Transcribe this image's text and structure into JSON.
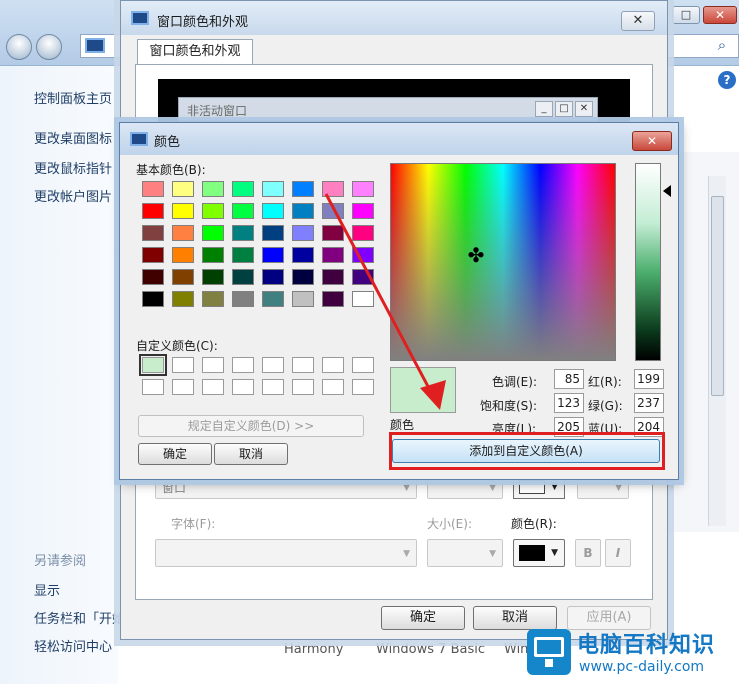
{
  "control_panel": {
    "sidebar_links": [
      "控制面板主页",
      "更改桌面图标",
      "更改鼠标指针",
      "更改帐户图片"
    ],
    "see_also_title": "另请参阅",
    "see_also_links": [
      "显示",
      "任务栏和「开始」菜单",
      "轻松访问中心"
    ],
    "bottom_themes": [
      "Harmony",
      "Windows 7 Basic",
      "Windows"
    ]
  },
  "window_color_dialog": {
    "title": "窗口颜色和外观",
    "tab": "窗口颜色和外观",
    "inactive_window_label": "非活动窗口",
    "item_value": "窗口",
    "font_label": "字体(F):",
    "size_label": "大小(E):",
    "color_label": "颜色(R):",
    "bold_label": "B",
    "italic_label": "I",
    "ok": "确定",
    "cancel": "取消",
    "apply": "应用(A)"
  },
  "color_dialog": {
    "title": "颜色",
    "basic_colors_label": "基本颜色(B):",
    "custom_colors_label": "自定义颜色(C):",
    "define_custom_button": "规定自定义颜色(D) >>",
    "ok": "确定",
    "cancel": "取消",
    "color_solid_label": "颜色",
    "hue_label": "色调(E):",
    "saturation_label": "饱和度(S):",
    "luminance_label": "亮度(L):",
    "red_label": "红(R):",
    "green_label": "绿(G):",
    "blue_label": "蓝(U):",
    "hue": "85",
    "saturation": "123",
    "luminance": "205",
    "red": "199",
    "green": "237",
    "blue": "204",
    "add_to_custom_button": "添加到自定义颜色(A)",
    "basic_colors": [
      "#ff8080",
      "#ffff80",
      "#80ff80",
      "#00ff80",
      "#80ffff",
      "#0080ff",
      "#ff80c0",
      "#ff80ff",
      "#ff0000",
      "#ffff00",
      "#80ff00",
      "#00ff40",
      "#00ffff",
      "#0080c0",
      "#8080c0",
      "#ff00ff",
      "#804040",
      "#ff8040",
      "#00ff00",
      "#008080",
      "#004080",
      "#8080ff",
      "#800040",
      "#ff0080",
      "#800000",
      "#ff8000",
      "#008000",
      "#008040",
      "#0000ff",
      "#0000a0",
      "#800080",
      "#8000ff",
      "#400000",
      "#804000",
      "#004000",
      "#004040",
      "#000080",
      "#000040",
      "#400040",
      "#400080",
      "#000000",
      "#808000",
      "#808040",
      "#808080",
      "#408080",
      "#c0c0c0",
      "#400040",
      "#ffffff"
    ],
    "custom_colors": [
      "#c7edcc",
      "#ffffff",
      "#ffffff",
      "#ffffff",
      "#ffffff",
      "#ffffff",
      "#ffffff",
      "#ffffff",
      "#ffffff",
      "#ffffff",
      "#ffffff",
      "#ffffff",
      "#ffffff",
      "#ffffff",
      "#ffffff",
      "#ffffff"
    ],
    "selected_color": "#c7edcc"
  },
  "watermark": {
    "name": "电脑百科知识",
    "url": "www.pc-daily.com"
  },
  "colors": {
    "annotation_red": "#e02020",
    "watermark_blue": "#1478c4"
  }
}
